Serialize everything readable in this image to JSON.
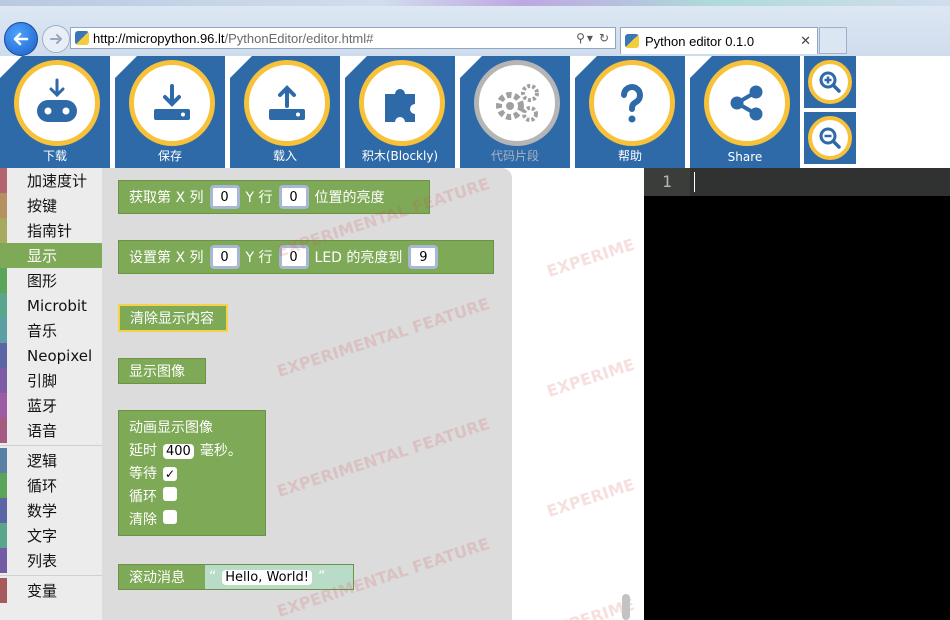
{
  "browser": {
    "url_host": "http://micropython.96.lt",
    "url_path": "/PythonEditor/editor.html#",
    "search_glyph": "⚲",
    "dropdown_glyph": "▾",
    "refresh_glyph": "↻",
    "tab_title": "Python editor 0.1.0",
    "tab_close": "✕"
  },
  "toolbar": {
    "download": "下载",
    "save": "保存",
    "load": "载入",
    "blockly": "积木(Blockly)",
    "snippets": "代码片段",
    "help": "帮助",
    "share": "Share"
  },
  "categories": [
    {
      "label": "加速度计",
      "color": "#b2656f"
    },
    {
      "label": "按键",
      "color": "#b59060"
    },
    {
      "label": "指南针",
      "color": "#a8a85e"
    },
    {
      "label": "显示",
      "color": "#7ea957",
      "selected": true
    },
    {
      "label": "图形",
      "color": "#5ba55b"
    },
    {
      "label": "Microbit",
      "color": "#5ba58c"
    },
    {
      "label": "音乐",
      "color": "#5b9fa5"
    },
    {
      "label": "Neopixel",
      "color": "#5b67a5"
    },
    {
      "label": "引脚",
      "color": "#7e5ba5"
    },
    {
      "label": "蓝牙",
      "color": "#9e5ba5"
    },
    {
      "label": "语音",
      "color": "#a55b80"
    },
    {
      "label": "逻辑",
      "color": "#5b80a5"
    },
    {
      "label": "循环",
      "color": "#5ba55b"
    },
    {
      "label": "数学",
      "color": "#5b67a5"
    },
    {
      "label": "文字",
      "color": "#5ba58c"
    },
    {
      "label": "列表",
      "color": "#745ba5"
    },
    {
      "label": "变量",
      "color": "#a55b5b"
    }
  ],
  "blocks": {
    "get_brightness": {
      "pre": "获取第 X 列",
      "x": "0",
      "mid": "Y 行",
      "y": "0",
      "post": "位置的亮度"
    },
    "set_brightness": {
      "pre": "设置第 X 列",
      "x": "0",
      "mid": "Y 行",
      "y": "0",
      "post": "LED 的亮度到",
      "val": "9"
    },
    "clear": "清除显示内容",
    "show_image": "显示图像",
    "animate": {
      "title": "动画显示图像",
      "delay_pre": "延时",
      "delay_val": "400",
      "delay_post": "毫秒。",
      "wait": "等待",
      "wait_mark": "✓",
      "loop": "循环",
      "clear": "清除"
    },
    "scroll": {
      "label": "滚动消息",
      "open_quote": "“",
      "text": "Hello, World!",
      "close_quote": "”"
    }
  },
  "watermark": "EXPERIMENTAL FEATURE",
  "editor": {
    "line_number": "1"
  }
}
